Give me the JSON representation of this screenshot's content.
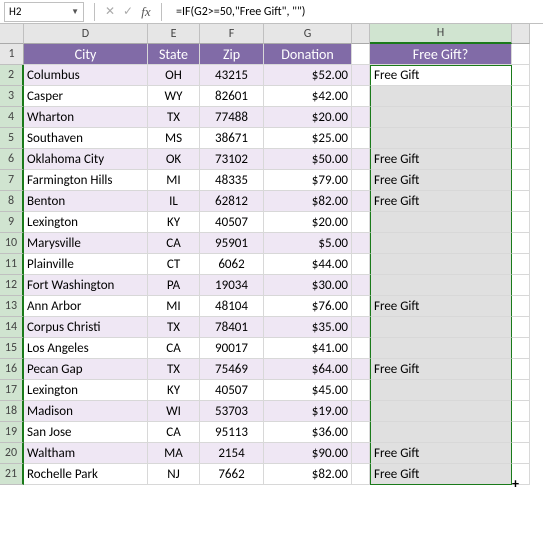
{
  "nameBox": "H2",
  "formula": "=IF(G2>=50,\"Free Gift\", \"\")",
  "columns": [
    "D",
    "E",
    "F",
    "G",
    "",
    "H",
    ""
  ],
  "headers": {
    "city": "City",
    "state": "State",
    "zip": "Zip",
    "donation": "Donation",
    "freeGift": "Free Gift?"
  },
  "rows": [
    {
      "n": "2",
      "city": "Columbus",
      "state": "OH",
      "zip": "43215",
      "don": "$52.00",
      "gift": "Free Gift"
    },
    {
      "n": "3",
      "city": "Casper",
      "state": "WY",
      "zip": "82601",
      "don": "$42.00",
      "gift": ""
    },
    {
      "n": "4",
      "city": "Wharton",
      "state": "TX",
      "zip": "77488",
      "don": "$20.00",
      "gift": ""
    },
    {
      "n": "5",
      "city": "Southaven",
      "state": "MS",
      "zip": "38671",
      "don": "$25.00",
      "gift": ""
    },
    {
      "n": "6",
      "city": "Oklahoma City",
      "state": "OK",
      "zip": "73102",
      "don": "$50.00",
      "gift": "Free Gift"
    },
    {
      "n": "7",
      "city": "Farmington Hills",
      "state": "MI",
      "zip": "48335",
      "don": "$79.00",
      "gift": "Free Gift"
    },
    {
      "n": "8",
      "city": "Benton",
      "state": "IL",
      "zip": "62812",
      "don": "$82.00",
      "gift": "Free Gift"
    },
    {
      "n": "9",
      "city": "Lexington",
      "state": "KY",
      "zip": "40507",
      "don": "$20.00",
      "gift": ""
    },
    {
      "n": "10",
      "city": "Marysville",
      "state": "CA",
      "zip": "95901",
      "don": "$5.00",
      "gift": ""
    },
    {
      "n": "11",
      "city": "Plainville",
      "state": "CT",
      "zip": "6062",
      "don": "$44.00",
      "gift": ""
    },
    {
      "n": "12",
      "city": "Fort Washington",
      "state": "PA",
      "zip": "19034",
      "don": "$30.00",
      "gift": ""
    },
    {
      "n": "13",
      "city": "Ann Arbor",
      "state": "MI",
      "zip": "48104",
      "don": "$76.00",
      "gift": "Free Gift"
    },
    {
      "n": "14",
      "city": "Corpus Christi",
      "state": "TX",
      "zip": "78401",
      "don": "$35.00",
      "gift": ""
    },
    {
      "n": "15",
      "city": "Los Angeles",
      "state": "CA",
      "zip": "90017",
      "don": "$41.00",
      "gift": ""
    },
    {
      "n": "16",
      "city": "Pecan Gap",
      "state": "TX",
      "zip": "75469",
      "don": "$64.00",
      "gift": "Free Gift"
    },
    {
      "n": "17",
      "city": "Lexington",
      "state": "KY",
      "zip": "40507",
      "don": "$45.00",
      "gift": ""
    },
    {
      "n": "18",
      "city": "Madison",
      "state": "WI",
      "zip": "53703",
      "don": "$19.00",
      "gift": ""
    },
    {
      "n": "19",
      "city": "San Jose",
      "state": "CA",
      "zip": "95113",
      "don": "$36.00",
      "gift": ""
    },
    {
      "n": "20",
      "city": "Waltham",
      "state": "MA",
      "zip": "2154",
      "don": "$90.00",
      "gift": "Free Gift"
    },
    {
      "n": "21",
      "city": "Rochelle Park",
      "state": "NJ",
      "zip": "7662",
      "don": "$82.00",
      "gift": "Free Gift"
    }
  ]
}
